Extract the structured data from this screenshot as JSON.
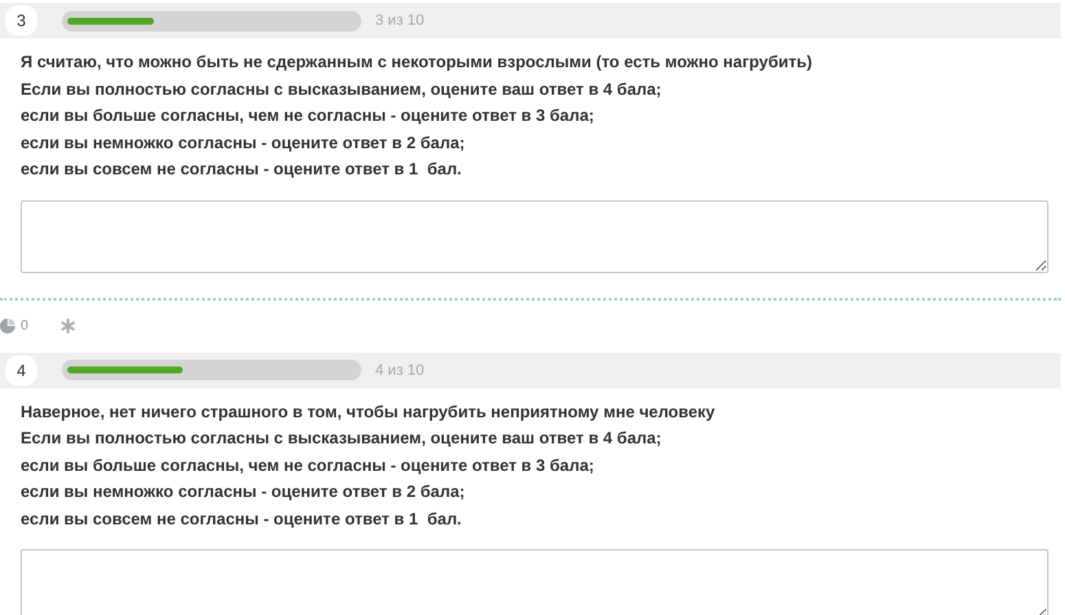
{
  "questions": [
    {
      "number": "3",
      "level": 0.3,
      "progress": "3 из 10",
      "lines": [
        "Я считаю, что можно быть не сдержанным с некоторыми взрослыми (то есть можно нагрубить)",
        "Если вы полностью согласны с высказыванием, оцените ваш ответ в 4 бала;",
        "если вы больше согласны, чем не согласны - оцените ответ в 3 бала;",
        "если вы немножко согласны - оцените ответ в 2 бала;",
        "если вы совсем не согласны - оцените ответ в 1  бал."
      ],
      "meta": {
        "count": "0"
      }
    },
    {
      "number": "4",
      "level": 0.4,
      "progress": "4 из 10",
      "lines": [
        "Наверное, нет ничего страшного в том, чтобы нагрубить неприятному мне человеку",
        "Если вы полностью согласны с высказыванием, оцените ваш ответ в 4 бала;",
        "если вы больше согласны, чем не согласны - оцените ответ в 3 бала;",
        "если вы немножко согласны - оцените ответ в 2 бала;",
        "если вы совсем не согласны - оцените ответ в 1  бал."
      ]
    }
  ]
}
